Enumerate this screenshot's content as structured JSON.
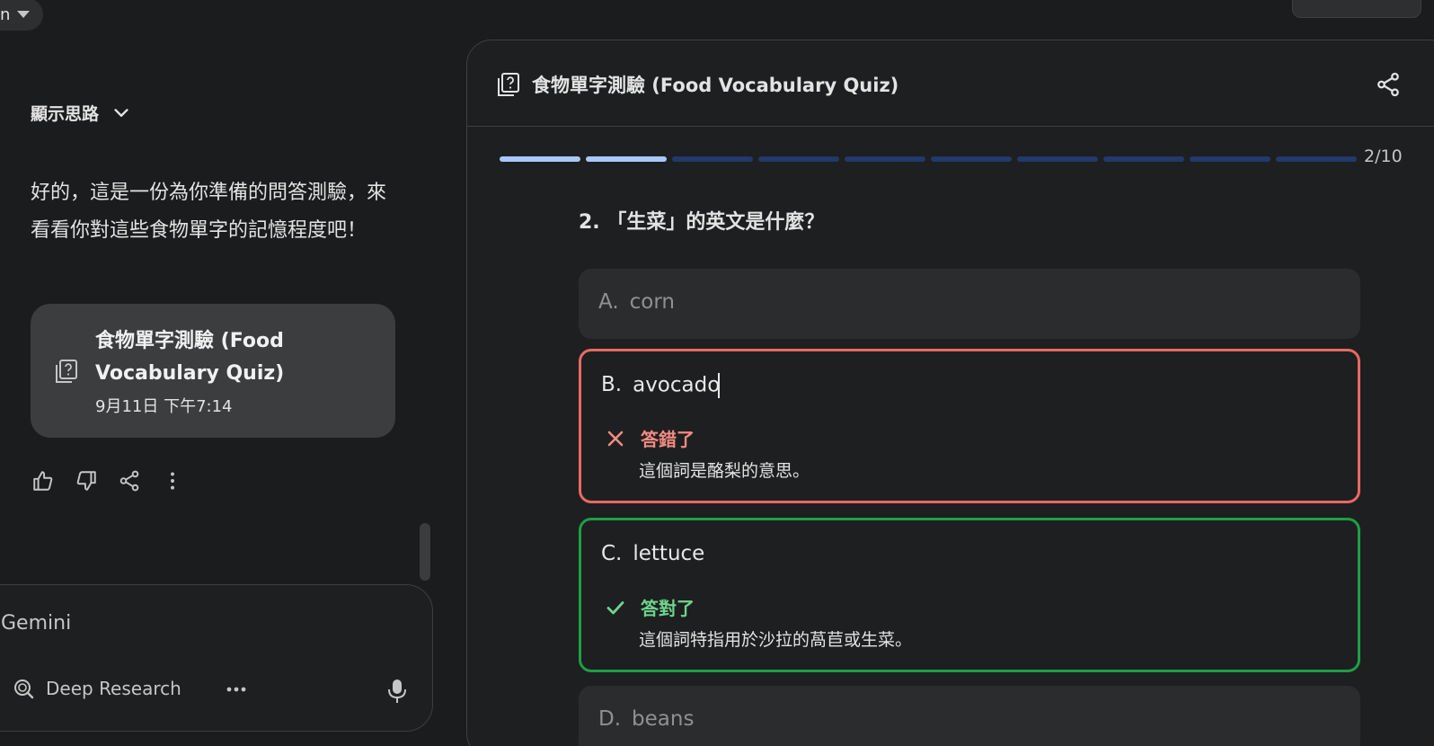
{
  "topbar": {
    "model_selector_label": "n"
  },
  "chat": {
    "show_thinking_label": "顯示思路",
    "reply_text": "好的，這是一份為你準備的問答測驗，來看看你對這些食物單字的記憶程度吧！",
    "quiz_card": {
      "title": "食物單字測驗 (Food Vocabulary Quiz)",
      "date": "9月11日 下午7:14",
      "icon": "quiz-icon"
    },
    "feedback": {
      "icons": [
        "thumbs-up-icon",
        "thumbs-down-icon",
        "share-icon",
        "more-vert-icon"
      ]
    },
    "input": {
      "placeholder": "Gemini",
      "deep_research_label": "Deep Research",
      "more_label": "•••"
    }
  },
  "quiz_panel": {
    "title": "食物單字測驗 (Food Vocabulary Quiz)",
    "progress": {
      "current": 2,
      "total": 10,
      "label": "2/10"
    },
    "question": "2. 「生菜」的英文是什麼？",
    "options": [
      {
        "letter": "A.",
        "text": "corn",
        "state": "disabled"
      },
      {
        "letter": "B.",
        "text": "avocado",
        "state": "wrong",
        "verdict": "答錯了",
        "explanation": "這個詞是酪梨的意思。"
      },
      {
        "letter": "C.",
        "text": "lettuce",
        "state": "correct",
        "verdict": "答對了",
        "explanation": "這個詞特指用於沙拉的萵苣或生菜。"
      },
      {
        "letter": "D.",
        "text": "beans",
        "state": "disabled"
      }
    ]
  },
  "colors": {
    "background": "#1b1c1d",
    "card": "#3b3d3f",
    "wrong": "#e86a64",
    "correct": "#1e9e45",
    "progress_done": "#a8c7fa",
    "progress_todo": "#1f3a6b"
  }
}
